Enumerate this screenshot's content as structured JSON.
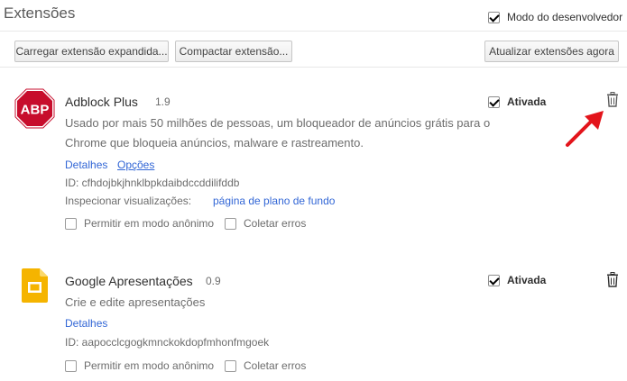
{
  "page": {
    "title": "Extensões",
    "dev_mode_label": "Modo do desenvolvedor",
    "dev_mode_checked": true
  },
  "toolbar": {
    "load_unpacked": "Carregar extensão expandida...",
    "pack": "Compactar extensão...",
    "update": "Atualizar extensões agora"
  },
  "extensions": [
    {
      "icon": "abp-logo",
      "icon_text": "ABP",
      "name": "Adblock Plus",
      "version": "1.9",
      "description_line1": "Usado por mais 50 milhões de pessoas, um bloqueador de anúncios grátis para o",
      "description_line2": "Chrome que bloqueia anúncios, malware e rastreamento.",
      "details_link": "Detalhes",
      "options_link": "Opções",
      "id_text": "ID: cfhdojbkjhnklbpkdaibdccddilifddb",
      "inspect_label": "Inspecionar visualizações:",
      "inspect_link": "página de plano de fundo",
      "incognito_label": "Permitir em modo anônimo",
      "errors_label": "Coletar erros",
      "enabled_label": "Ativada",
      "enabled": true,
      "trash_icon": "trash-icon"
    },
    {
      "icon": "google-slides-icon",
      "name": "Google Apresentações",
      "version": "0.9",
      "description_line1": "Crie e edite apresentações",
      "details_link": "Detalhes",
      "id_text": "ID: aapocclcgogkmnckokdopfmhonfmgoek",
      "incognito_label": "Permitir em modo anônimo",
      "errors_label": "Coletar erros",
      "enabled_label": "Ativada",
      "enabled": true,
      "trash_icon": "trash-icon"
    }
  ],
  "annotation": {
    "icon": "red-arrow-icon",
    "color": "#e3141b"
  },
  "colors": {
    "link": "#3367d6",
    "abp_red": "#c70d2c",
    "slides_yellow": "#f5b400"
  }
}
